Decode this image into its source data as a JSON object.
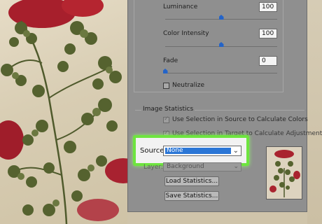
{
  "adjustments": {
    "luminance": {
      "label": "Luminance",
      "value": "100",
      "level": 0.5
    },
    "color_intensity": {
      "label": "Color Intensity",
      "value": "100",
      "level": 0.5
    },
    "fade": {
      "label": "Fade",
      "value": "0",
      "level": 0.0
    },
    "neutralize": {
      "label": "Neutralize",
      "checked": false
    }
  },
  "image_statistics": {
    "title": "Image Statistics",
    "use_selection_source": {
      "label": "Use Selection in Source to Calculate Colors",
      "checked": true
    },
    "use_selection_target": {
      "label": "Use Selection in Target to Calculate Adjustment",
      "checked": true
    },
    "source": {
      "label": "Source:",
      "value": "None"
    },
    "layer": {
      "label": "Layer:",
      "value": "Background"
    },
    "load_button": "Load Statistics...",
    "save_button": "Save Statistics..."
  },
  "colors": {
    "highlight": "#6ee43f",
    "selection": "#2b76d6",
    "slider_thumb": "#2464c8"
  }
}
